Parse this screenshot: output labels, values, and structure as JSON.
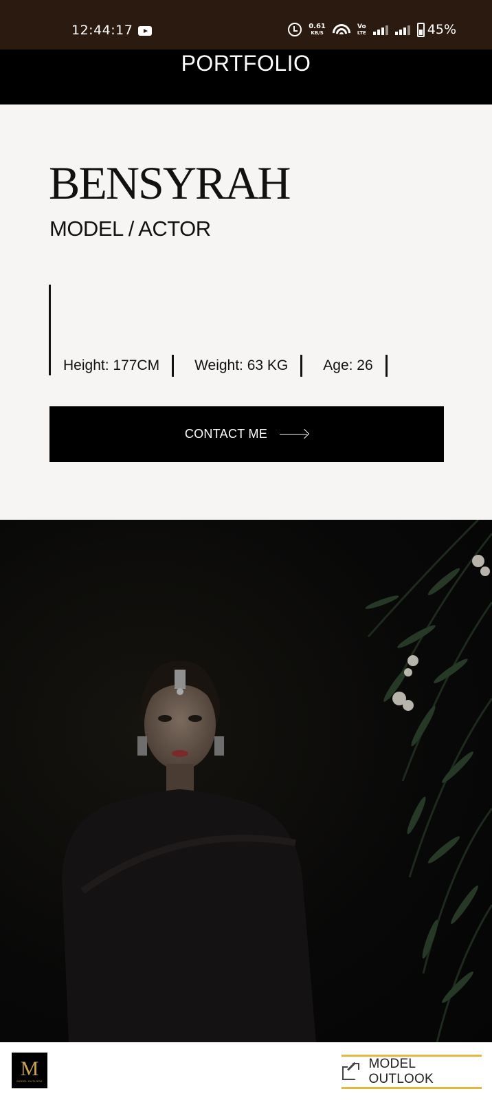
{
  "status_bar": {
    "time": "12:44:17",
    "net_speed": "0.61",
    "net_unit": "KB/S",
    "volte": "Vo",
    "volte_sub": "LTE",
    "battery": "45%"
  },
  "header": {
    "title": "PORTFOLIO"
  },
  "profile": {
    "name": "BENSYRAH",
    "role": "MODEL / ACTOR",
    "stats": {
      "height": "Height: 177CM",
      "weight": "Weight: 63 KG",
      "age": "Age: 26"
    },
    "contact_label": "CONTACT ME"
  },
  "footer": {
    "logo_mark": "M",
    "logo_sub": "MODEL OUTLOOK",
    "link_label": "MODEL OUTLOOK",
    "accent_color": "#e5b83b"
  }
}
